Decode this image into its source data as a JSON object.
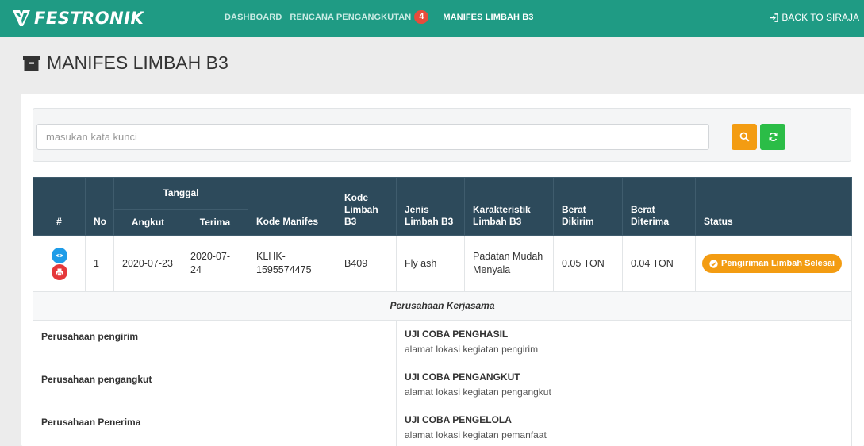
{
  "navbar": {
    "brand": "FESTRONIK",
    "links": [
      {
        "label": "DASHBOARD"
      },
      {
        "label": "RENCANA PENGANGKUTAN",
        "badge": "4"
      },
      {
        "label": "MANIFES LIMBAH B3"
      }
    ],
    "back_label": "BACK TO SIRAJA",
    "colors": {
      "bar": "#1f9b84",
      "badge": "#e74c3c"
    }
  },
  "page": {
    "title": "MANIFES LIMBAH B3"
  },
  "search": {
    "placeholder": "masukan kata kunci",
    "value": ""
  },
  "table": {
    "headers": {
      "hash": "#",
      "no": "No",
      "tanggal": "Tanggal",
      "angkut": "Angkut",
      "terima": "Terima",
      "kode_manifes": "Kode Manifes",
      "kode_limbah_b3": "Kode Limbah B3",
      "jenis_limbah_b3": "Jenis Limbah B3",
      "karakteristik": "Karakteristik Limbah B3",
      "berat_dikirim": "Berat Dikirim",
      "berat_diterima": "Berat Diterima",
      "status": "Status"
    },
    "rows": [
      {
        "no": "1",
        "angkut": "2020-07-23",
        "terima": "2020-07-24",
        "kode_manifes": "KLHK-1595574475",
        "kode_limbah": "B409",
        "jenis": "Fly ash",
        "karakteristik": "Padatan Mudah Menyala",
        "berat_dikirim": "0.05 TON",
        "berat_diterima": "0.04 TON",
        "status": "Pengiriman Limbah Selesai"
      }
    ],
    "section_title": "Perusahaan Kerjasama",
    "companies": [
      {
        "label": "Perusahaan pengirim",
        "name": "UJI COBA PENGHASIL",
        "address": "alamat lokasi kegiatan pengirim"
      },
      {
        "label": "Perusahaan pengangkut",
        "name": "UJI COBA PENGANGKUT",
        "address": "alamat lokasi kegiatan pengangkut"
      },
      {
        "label": "Perusahaan Penerima",
        "name": "UJI COBA PENGELOLA",
        "address": "alamat lokasi kegiatan pemanfaat"
      }
    ],
    "colors": {
      "header": "#2d4a5b",
      "status": "#f39c12",
      "view": "#1e9ce8",
      "print": "#e5383b"
    }
  }
}
